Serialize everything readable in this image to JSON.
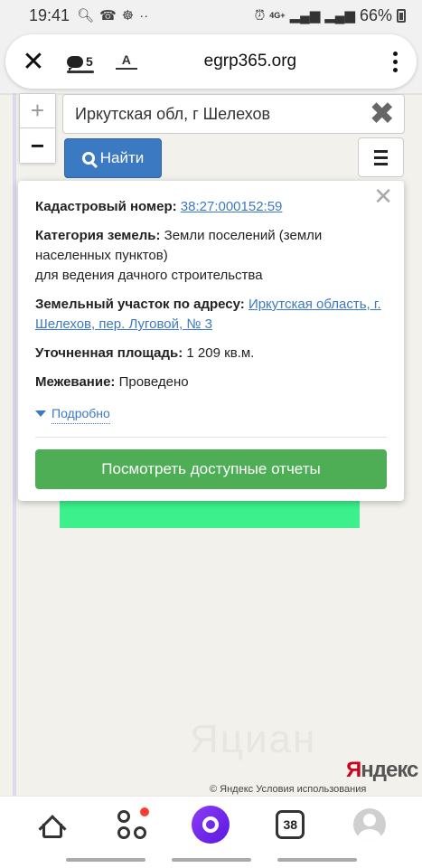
{
  "status_bar": {
    "time": "19:41",
    "network": "4G+",
    "battery": "66%"
  },
  "browser": {
    "comments_count": "5",
    "url": "egrp365.org"
  },
  "map": {
    "search_value": "Иркутская обл, г Шелехов",
    "find_label": "Найти",
    "zoom_in": "+",
    "zoom_out": "−",
    "watermark": "Яциан",
    "yandex_logo_first": "Я",
    "yandex_logo_rest": "ндекс",
    "copyright": "© Яндекс  Условия использования"
  },
  "popup": {
    "cadastral_label": "Кадастровый номер:",
    "cadastral_value": "38:27:000152:59",
    "category_label": "Категория земель:",
    "category_value": "Земли поселений (земли населенных пунктов)",
    "category_usage": "для ведения дачного строительства",
    "address_label": "Земельный участок по адресу:",
    "address_value": "Иркутская область, г. Шелехов, пер. Луговой, № 3",
    "area_label": "Уточненная площадь:",
    "area_value": "1 209 кв.м.",
    "survey_label": "Межевание:",
    "survey_value": "Проведено",
    "details_label": "Подробно",
    "reports_button": "Посмотреть доступные отчеты"
  },
  "bottom_nav": {
    "tabs_count": "38"
  },
  "colors": {
    "accent_blue": "#3b79c3",
    "button_green": "#4dae55",
    "plot_green": "#3cf08c",
    "alice_purple": "#7a2bf2"
  }
}
